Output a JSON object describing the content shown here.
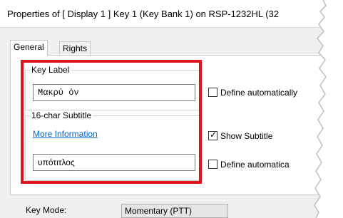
{
  "window": {
    "title": "Properties of [ Display 1 ] Key 1 (Key Bank 1) on RSP-1232HL (32"
  },
  "tabs": [
    {
      "label": "General",
      "active": true
    },
    {
      "label": "Rights",
      "active": false
    }
  ],
  "key_label_group": {
    "label": "Key Label",
    "value": "Μακρύ όν",
    "define_auto_label": "Define automatically",
    "define_auto_checked": false
  },
  "subtitle_group": {
    "label": "16-char Subtitle",
    "link": "More Information",
    "value": "υπότιτλος",
    "show_subtitle_label": "Show Subtitle",
    "show_subtitle_checked": true,
    "define_auto_label": "Define automatica",
    "define_auto_checked": false
  },
  "key_mode": {
    "label": "Key Mode:",
    "value": "Momentary (PTT)"
  },
  "colors": {
    "highlight": "#e0141e",
    "link": "#0066cc",
    "dialog_bg": "#f0f0f0"
  }
}
